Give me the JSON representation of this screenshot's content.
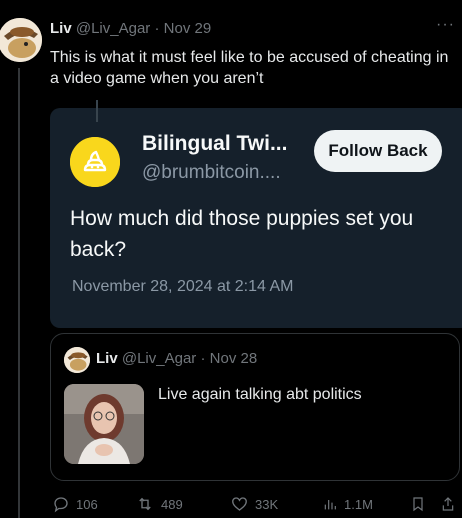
{
  "tweet": {
    "author_name": "Liv",
    "author_handle": "@Liv_Agar",
    "separator": "·",
    "date": "Nov 29",
    "more": "···",
    "text": "This is what it must feel like to be accused of cheating in a video game when you aren’t"
  },
  "embedded": {
    "name": "Bilingual Twi...",
    "handle": "@brumbitcoin....",
    "follow_label": "Follow Back",
    "body": "How much did those puppies set you back?",
    "timestamp": "November 28, 2024 at 2:14 AM"
  },
  "quote": {
    "author_name": "Liv",
    "author_handle": "@Liv_Agar",
    "separator": "·",
    "date": "Nov 28",
    "text": "Live again talking abt politics"
  },
  "actions": {
    "replies": "106",
    "reposts": "489",
    "likes": "33K",
    "views": "1.1M"
  },
  "colors": {
    "background": "#000000",
    "card_background": "#15202b",
    "muted": "#71767b",
    "avatar_yellow": "#f9d71c"
  }
}
